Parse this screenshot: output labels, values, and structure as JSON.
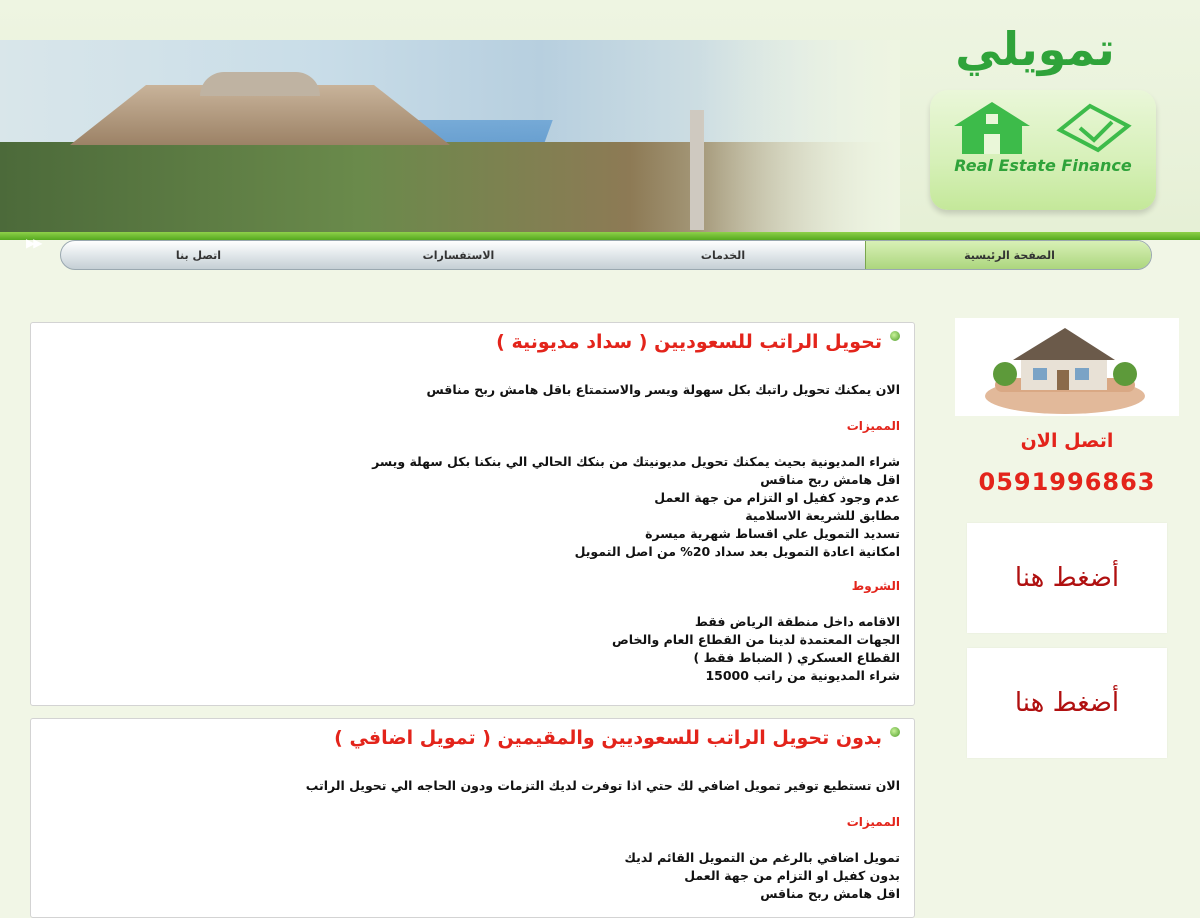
{
  "brand": {
    "name": "تمويلي",
    "logo_text": "Real Estate Finance"
  },
  "nav": {
    "items": [
      {
        "label": "الصفحة الرئيسية"
      },
      {
        "label": "الخدمات"
      },
      {
        "label": "الاستفسارات"
      },
      {
        "label": "اتصل بنا"
      }
    ]
  },
  "colors": {
    "accent_green": "#2fa33a",
    "heading_red": "#e3241b"
  },
  "offer1": {
    "title": "تحويل الراتب للسعوديين ( سداد مديونية )",
    "intro": "الان يمكنك تحويل راتبك بكل سهولة ويسر والاستمتاع باقل هامش ربح مناقس",
    "features_label": "المميزات",
    "features": [
      "شراء المديونية بحيث يمكنك تحويل مديونيتك من بنكك الحالي الي بنكنا بكل سهلة ويسر",
      "اقل هامش ربح مناقس",
      "عدم وجود كفيل او التزام من جهة العمل",
      "مطابق للشريعة الاسلامية",
      "تسديد التمويل علي اقساط شهرية ميسرة",
      "امكانية اعادة التمويل بعد سداد 20% من اصل التمويل"
    ],
    "terms_label": "الشروط",
    "terms": [
      "الاقامه داخل منطقة الرياض فقط",
      "الجهات المعتمدة لدينا من القطاع العام والخاص",
      "القطاع العسكري ( الضباط فقط )",
      "شراء المديونية من راتب 15000"
    ]
  },
  "offer2": {
    "title": "بدون تحويل الراتب للسعوديين والمقيمين ( تمويل اضافي )",
    "intro": "الان تستطيع توفير تمويل اضافي لك حتي اذا توفرت لديك التزمات ودون الحاجه الي تحويل الراتب",
    "features_label": "المميزات",
    "features": [
      "تمويل اضافي بالرغم من التمويل القائم لديك",
      "بدون كفيل او التزام من جهة العمل",
      "اقل هامش ربح مناقس"
    ]
  },
  "sidebar": {
    "call_label": "اتصل الان",
    "phone": "0591996863",
    "click_here_1": "أضغط هنا",
    "click_here_2": "أضغط هنا"
  }
}
